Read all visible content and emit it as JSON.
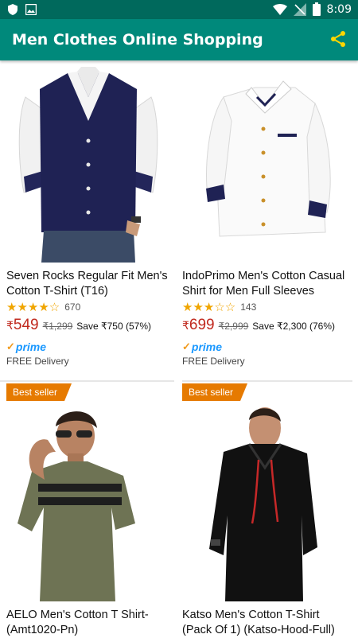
{
  "status_bar": {
    "time": "8:09"
  },
  "app_bar": {
    "title": "Men Clothes Online Shopping",
    "share_icon": "share-icon"
  },
  "colors": {
    "primary": "#00897b",
    "primary_dark": "#00695c",
    "accent": "#ffd600",
    "price": "#c0281d",
    "badge": "#e67a00",
    "prime": "#1a98ff"
  },
  "products": [
    {
      "name": "Seven Rocks Regular Fit Men's Cotton T-Shirt (T16)",
      "rating": 4,
      "rating_count": "670",
      "currency": "₹",
      "price": "549",
      "mrp": "₹1,299",
      "save": "Save ₹750 (57%)",
      "prime": "prime",
      "delivery": "FREE Delivery"
    },
    {
      "name": "IndoPrimo Men's Cotton Casual Shirt for Men Full Sleeves",
      "rating": 3,
      "rating_count": "143",
      "currency": "₹",
      "price": "699",
      "mrp": "₹2,999",
      "save": "Save ₹2,300 (76%)",
      "prime": "prime",
      "delivery": "FREE Delivery"
    },
    {
      "badge": "Best seller",
      "name": "AELO Men's Cotton T Shirt-(Amt1020-Pn)"
    },
    {
      "badge": "Best seller",
      "name": "Katso Men's Cotton T-Shirt (Pack Of 1) (Katso-Hood-Full)"
    }
  ]
}
